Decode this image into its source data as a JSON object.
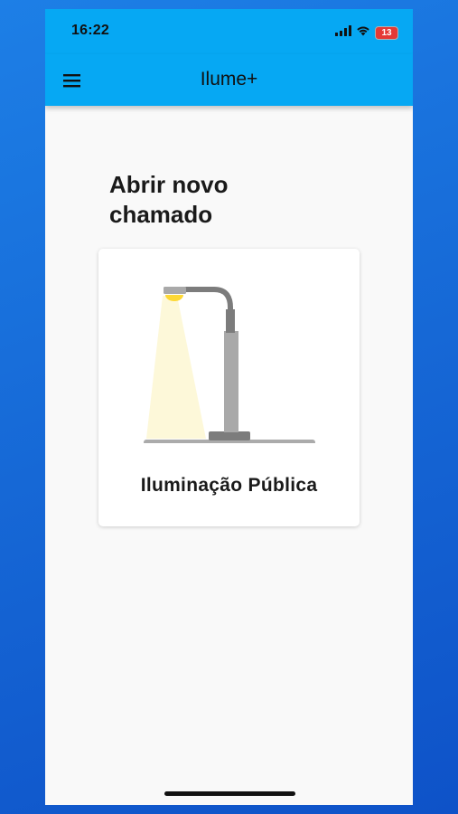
{
  "status_bar": {
    "time": "16:22",
    "battery_level": "13",
    "icons": [
      "signal-icon",
      "wifi-icon",
      "battery-icon"
    ]
  },
  "app_bar": {
    "title": "Ilume+",
    "menu_icon": "menu-icon"
  },
  "main": {
    "section_title": "Abrir novo chamado",
    "categories": [
      {
        "label": "Iluminação Pública",
        "icon": "street-lamp-icon"
      }
    ]
  },
  "colors": {
    "app_bar": "#06a8f3",
    "background": "#1668d6",
    "screen": "#f9f9f9",
    "lamp_light": "#fdd835"
  }
}
